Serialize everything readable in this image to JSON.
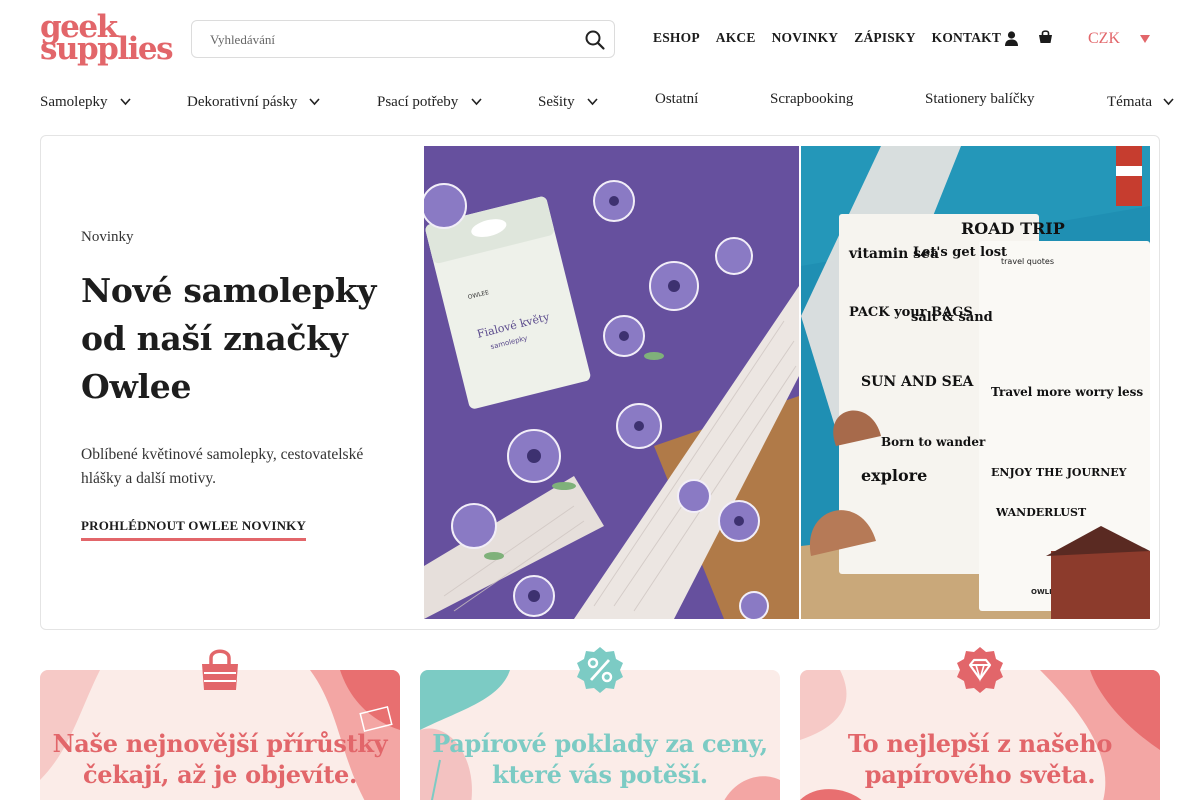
{
  "brand": {
    "logo_line1": "geek",
    "logo_line2": "supplies",
    "accent": "#e2666a",
    "teal": "#7ccbc4"
  },
  "search": {
    "placeholder": "Vyhledávání"
  },
  "topnav": {
    "items": [
      "ESHOP",
      "AKCE",
      "NOVINKY",
      "ZÁPISKY",
      "KONTAKT"
    ],
    "currency": "CZK"
  },
  "categories": [
    {
      "label": "Samolepky",
      "has_dropdown": true
    },
    {
      "label": "Dekorativní pásky",
      "has_dropdown": true
    },
    {
      "label": "Psací potřeby",
      "has_dropdown": true
    },
    {
      "label": "Sešity",
      "has_dropdown": true
    },
    {
      "label": "Ostatní",
      "has_dropdown": false
    },
    {
      "label": "Scrapbooking",
      "has_dropdown": false
    },
    {
      "label": "Stationery balíčky",
      "has_dropdown": false
    },
    {
      "label": "Témata",
      "has_dropdown": true
    }
  ],
  "hero": {
    "kicker": "Novinky",
    "title": "Nové samolepky od naší značky Owlee",
    "description": "Oblíbené květinové samolepky, cestovatelské hlášky a další motivy.",
    "cta": "PROHLÉDNOUT OWLEE NOVINKY",
    "image1_label_line1": "Fialové květy",
    "image1_label_line2": "samolepky",
    "image1_brand": "OWLEE",
    "image2_header": "travel quotes",
    "image2_stickers": [
      "vitamin sea",
      "Let's get lost",
      "ROAD TRIP",
      "PACK your BAGS",
      "salt & sand",
      "SUN AND SEA",
      "Travel more worry less",
      "Born to wander",
      "explore",
      "ENJOY THE JOURNEY",
      "WANDERLUST"
    ],
    "image2_brand": "OWLEE"
  },
  "promos": [
    {
      "text": "Naše nejnovější přírůstky čekají, až je objevíte.",
      "icon": "shopping-bag-icon",
      "color": "#e2666a"
    },
    {
      "text": "Papírové poklady za ceny, které vás potěší.",
      "icon": "percent-icon",
      "color": "#7ccbc4"
    },
    {
      "text": "To nejlepší z našeho papírového světa.",
      "icon": "diamond-icon",
      "color": "#e2666a"
    }
  ]
}
